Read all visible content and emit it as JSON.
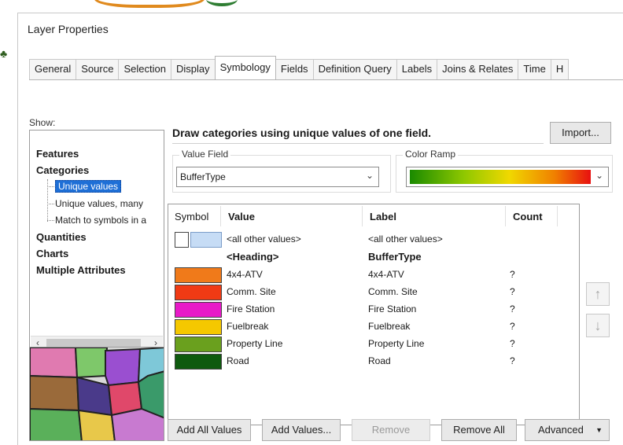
{
  "window": {
    "title": "Layer Properties"
  },
  "tabs": [
    {
      "label": "General"
    },
    {
      "label": "Source"
    },
    {
      "label": "Selection"
    },
    {
      "label": "Display"
    },
    {
      "label": "Symbology",
      "active": true
    },
    {
      "label": "Fields"
    },
    {
      "label": "Definition Query"
    },
    {
      "label": "Labels"
    },
    {
      "label": "Joins & Relates"
    },
    {
      "label": "Time"
    },
    {
      "label": "H"
    }
  ],
  "show": {
    "label": "Show:",
    "features": "Features",
    "categories": "Categories",
    "unique_values": "Unique values",
    "unique_values_many": "Unique values, many",
    "match_to_symbols": "Match to symbols in a",
    "quantities": "Quantities",
    "charts": "Charts",
    "multiple_attributes": "Multiple Attributes"
  },
  "description": "Draw categories using unique values of one field.",
  "import_button": "Import...",
  "value_field": {
    "label": "Value Field",
    "value": "BufferType"
  },
  "color_ramp": {
    "label": "Color Ramp"
  },
  "table": {
    "headers": {
      "symbol": "Symbol",
      "value": "Value",
      "label": "Label",
      "count": "Count"
    },
    "other": {
      "value": "<all other values>",
      "label": "<all other values>",
      "color": "#c6dcf5"
    },
    "heading": {
      "value": "<Heading>",
      "label": "BufferType"
    },
    "rows": [
      {
        "value": "4x4-ATV",
        "label": "4x4-ATV",
        "count": "?",
        "color": "#f07a1a"
      },
      {
        "value": "Comm. Site",
        "label": "Comm. Site",
        "count": "?",
        "color": "#f03a14"
      },
      {
        "value": "Fire Station",
        "label": "Fire Station",
        "count": "?",
        "color": "#e81ac8"
      },
      {
        "value": "Fuelbreak",
        "label": "Fuelbreak",
        "count": "?",
        "color": "#f5c800"
      },
      {
        "value": "Property Line",
        "label": "Property Line",
        "count": "?",
        "color": "#6aa01e"
      },
      {
        "value": "Road",
        "label": "Road",
        "count": "?",
        "color": "#0e5a0e"
      }
    ]
  },
  "buttons": {
    "add_all": "Add All Values",
    "add_values": "Add Values...",
    "remove": "Remove",
    "remove_all": "Remove All",
    "advanced": "Advanced"
  },
  "icons": {
    "up": "arrow-up-icon",
    "down": "arrow-down-icon",
    "scroll_left": "chevron-left-icon",
    "scroll_right": "chevron-right-icon",
    "dropdown": "chevron-down-icon"
  }
}
